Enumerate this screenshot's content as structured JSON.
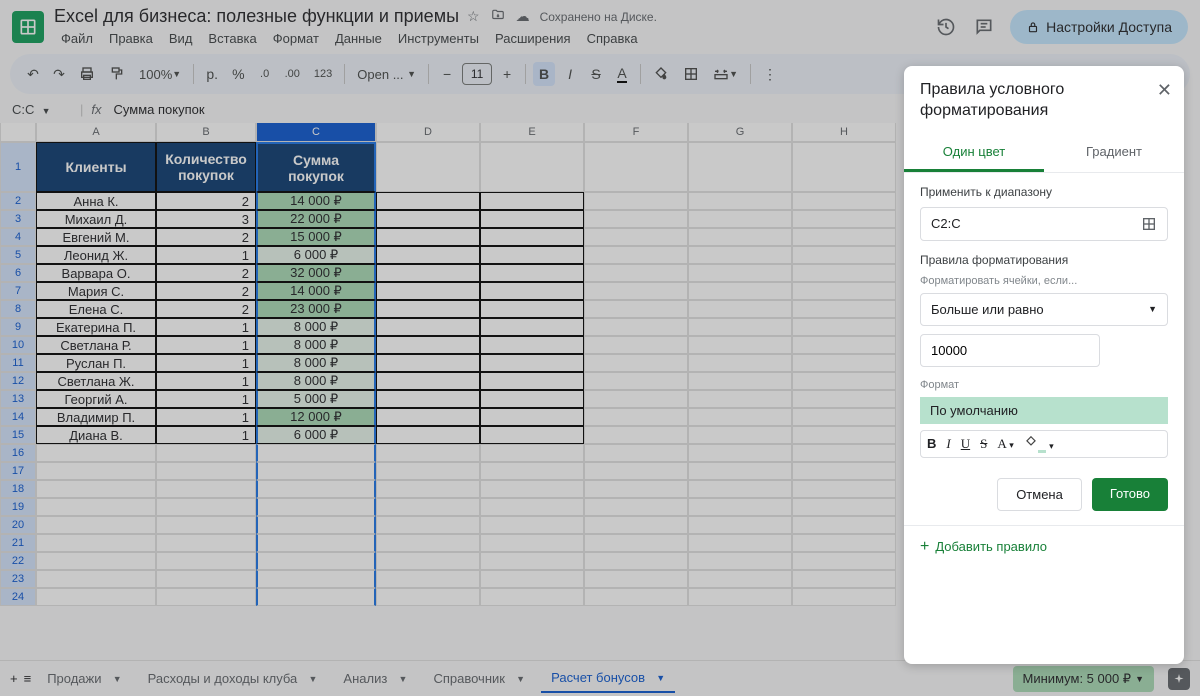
{
  "doc": {
    "title": "Excel для бизнеса: полезные функции и приемы",
    "saved": "Сохранено на Диске."
  },
  "menus": [
    "Файл",
    "Правка",
    "Вид",
    "Вставка",
    "Формат",
    "Данные",
    "Инструменты",
    "Расширения",
    "Справка"
  ],
  "share": "Настройки Доступа",
  "toolbar": {
    "zoom": "100%",
    "currency": "р.",
    "percent": "%",
    "dec_dec": ".0",
    "dec_inc": ".00",
    "num123": "123",
    "font": "Open ...",
    "fontsize": "11"
  },
  "namebox": {
    "ref": "C:C",
    "formula": "Сумма покупок"
  },
  "columns": [
    "A",
    "B",
    "C",
    "D",
    "E",
    "F",
    "G",
    "H"
  ],
  "headers": {
    "A": "Клиенты",
    "B": "Количество покупок",
    "C": "Сумма покупок"
  },
  "rows": [
    {
      "n": "Анна К.",
      "q": "2",
      "s": "14 000 ₽",
      "hl": "green"
    },
    {
      "n": "Михаил Д.",
      "q": "3",
      "s": "22 000 ₽",
      "hl": "green"
    },
    {
      "n": "Евгений М.",
      "q": "2",
      "s": "15 000 ₽",
      "hl": "green"
    },
    {
      "n": "Леонид Ж.",
      "q": "1",
      "s": "6 000 ₽",
      "hl": "light"
    },
    {
      "n": "Варвара О.",
      "q": "2",
      "s": "32 000 ₽",
      "hl": "green"
    },
    {
      "n": "Мария С.",
      "q": "2",
      "s": "14 000 ₽",
      "hl": "green"
    },
    {
      "n": "Елена С.",
      "q": "2",
      "s": "23 000 ₽",
      "hl": "green"
    },
    {
      "n": "Екатерина П.",
      "q": "1",
      "s": "8 000 ₽",
      "hl": "light"
    },
    {
      "n": "Светлана Р.",
      "q": "1",
      "s": "8 000 ₽",
      "hl": "light"
    },
    {
      "n": "Руслан П.",
      "q": "1",
      "s": "8 000 ₽",
      "hl": "light"
    },
    {
      "n": "Светлана Ж.",
      "q": "1",
      "s": "8 000 ₽",
      "hl": "light"
    },
    {
      "n": "Георгий А.",
      "q": "1",
      "s": "5 000 ₽",
      "hl": "light"
    },
    {
      "n": "Владимир П.",
      "q": "1",
      "s": "12 000 ₽",
      "hl": "green"
    },
    {
      "n": "Диана В.",
      "q": "1",
      "s": "6 000 ₽",
      "hl": "light"
    }
  ],
  "blankRows": 9,
  "tabs": [
    "Продажи",
    "Расходы и доходы клуба",
    "Анализ",
    "Справочник",
    "Расчет бонусов"
  ],
  "activeTab": 4,
  "sumchip": "Минимум: 5 000 ₽",
  "panel": {
    "title": "Правила условного форматирования",
    "tab1": "Один цвет",
    "tab2": "Градиент",
    "rangeLabel": "Применить к диапазону",
    "range": "C2:C",
    "rulesLabel": "Правила форматирования",
    "formatIf": "Форматировать ячейки, если...",
    "condition": "Больше или равно",
    "value": "10000",
    "formatLabel": "Формат",
    "preview": "По умолчанию",
    "cancel": "Отмена",
    "done": "Готово",
    "addRule": "Добавить правило"
  }
}
